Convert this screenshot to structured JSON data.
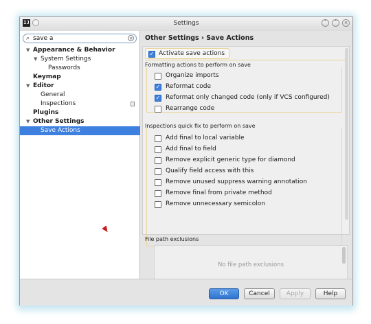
{
  "window": {
    "title": "Settings",
    "app_icon": "IJ",
    "controls": [
      {
        "name": "minimize-icon",
        "glyph": "˅"
      },
      {
        "name": "maximize-icon",
        "glyph": "˄"
      },
      {
        "name": "close-icon",
        "glyph": "×"
      }
    ]
  },
  "search": {
    "value": "save a",
    "icon": "search-icon",
    "clear_glyph": "×"
  },
  "tree": {
    "items": [
      {
        "label": "Appearance & Behavior",
        "arrow": "▼"
      },
      {
        "label": "System Settings",
        "arrow": "▼"
      },
      {
        "label": "Passwords"
      },
      {
        "label": "Keymap"
      },
      {
        "label": "Editor",
        "arrow": "▼"
      },
      {
        "label": "General"
      },
      {
        "label": "Inspections"
      },
      {
        "label": "Plugins"
      },
      {
        "label": "Other Settings",
        "arrow": "▼"
      },
      {
        "label": "Save Actions"
      }
    ]
  },
  "breadcrumb": "Other Settings › Save Actions",
  "activate": {
    "label": "Activate save actions",
    "checked": true
  },
  "formatting": {
    "title": "Formatting actions to perform on save",
    "options": [
      {
        "label": "Organize imports",
        "checked": false
      },
      {
        "label": "Reformat code",
        "checked": true
      },
      {
        "label": "Reformat only changed code (only if VCS configured)",
        "checked": true
      },
      {
        "label": "Rearrange code",
        "checked": false
      }
    ]
  },
  "inspections": {
    "title": "Inspections quick fix to perform on save",
    "options": [
      {
        "label": "Add final to local variable",
        "checked": false
      },
      {
        "label": "Add final to field",
        "checked": false
      },
      {
        "label": "Remove explicit generic type for diamond",
        "checked": false
      },
      {
        "label": "Qualify field access with this",
        "checked": false
      },
      {
        "label": "Remove unused suppress warning annotation",
        "checked": false
      },
      {
        "label": "Remove final from private method",
        "checked": false
      },
      {
        "label": "Remove unnecessary semicolon",
        "checked": false
      }
    ]
  },
  "exclusions": {
    "label": "File path exclusions",
    "placeholder": "No file path exclusions"
  },
  "buttons": {
    "ok": "OK",
    "cancel": "Cancel",
    "apply": "Apply",
    "help": "Help"
  },
  "colors": {
    "accent": "#3d80df",
    "group_border": "#e8d49a"
  }
}
